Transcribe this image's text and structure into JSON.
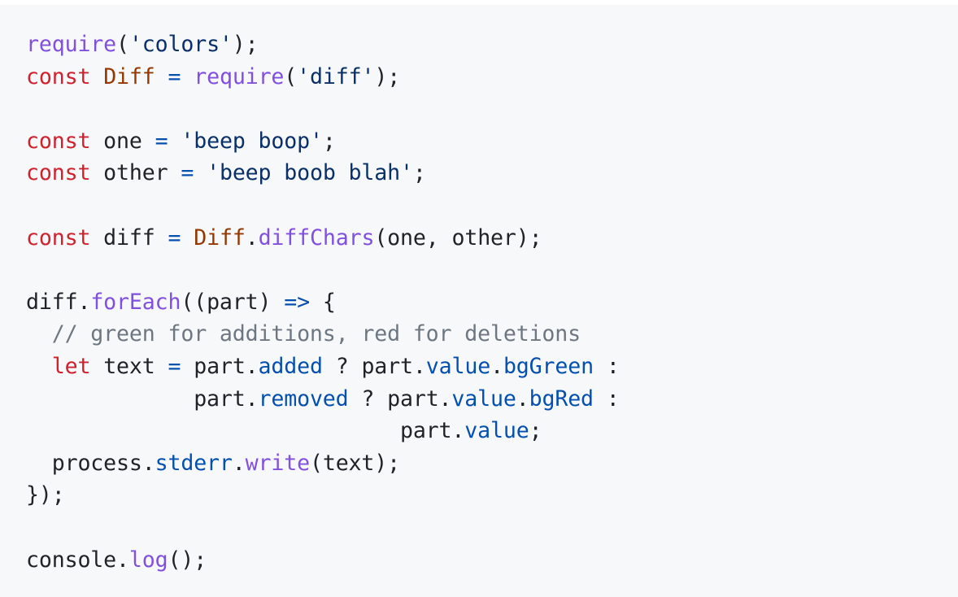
{
  "code_block": {
    "language": "javascript",
    "colors": {
      "background": "#f6f8fa",
      "text": "#1f2328",
      "keyword": "#cf222e",
      "function": "#8250df",
      "class": "#953800",
      "string": "#0a3069",
      "property": "#0550ae",
      "comment": "#6e7781"
    },
    "lines": [
      [
        {
          "t": "fn",
          "v": "require"
        },
        {
          "t": "tx",
          "v": "("
        },
        {
          "t": "str",
          "v": "'colors'"
        },
        {
          "t": "tx",
          "v": ");"
        }
      ],
      [
        {
          "t": "kw",
          "v": "const"
        },
        {
          "t": "tx",
          "v": " "
        },
        {
          "t": "cls",
          "v": "Diff"
        },
        {
          "t": "tx",
          "v": " "
        },
        {
          "t": "op",
          "v": "="
        },
        {
          "t": "tx",
          "v": " "
        },
        {
          "t": "fn",
          "v": "require"
        },
        {
          "t": "tx",
          "v": "("
        },
        {
          "t": "str",
          "v": "'diff'"
        },
        {
          "t": "tx",
          "v": ");"
        }
      ],
      [],
      [
        {
          "t": "kw",
          "v": "const"
        },
        {
          "t": "tx",
          "v": " one "
        },
        {
          "t": "op",
          "v": "="
        },
        {
          "t": "tx",
          "v": " "
        },
        {
          "t": "str",
          "v": "'beep boop'"
        },
        {
          "t": "tx",
          "v": ";"
        }
      ],
      [
        {
          "t": "kw",
          "v": "const"
        },
        {
          "t": "tx",
          "v": " other "
        },
        {
          "t": "op",
          "v": "="
        },
        {
          "t": "tx",
          "v": " "
        },
        {
          "t": "str",
          "v": "'beep boob blah'"
        },
        {
          "t": "tx",
          "v": ";"
        }
      ],
      [],
      [
        {
          "t": "kw",
          "v": "const"
        },
        {
          "t": "tx",
          "v": " diff "
        },
        {
          "t": "op",
          "v": "="
        },
        {
          "t": "tx",
          "v": " "
        },
        {
          "t": "cls",
          "v": "Diff"
        },
        {
          "t": "tx",
          "v": "."
        },
        {
          "t": "fn",
          "v": "diffChars"
        },
        {
          "t": "tx",
          "v": "(one, other);"
        }
      ],
      [],
      [
        {
          "t": "tx",
          "v": "diff."
        },
        {
          "t": "fn",
          "v": "forEach"
        },
        {
          "t": "tx",
          "v": "((part) "
        },
        {
          "t": "op",
          "v": "=>"
        },
        {
          "t": "tx",
          "v": " {"
        }
      ],
      [
        {
          "t": "cm",
          "v": "  // green for additions, red for deletions"
        }
      ],
      [
        {
          "t": "tx",
          "v": "  "
        },
        {
          "t": "kw",
          "v": "let"
        },
        {
          "t": "tx",
          "v": " text "
        },
        {
          "t": "op",
          "v": "="
        },
        {
          "t": "tx",
          "v": " part."
        },
        {
          "t": "prop",
          "v": "added"
        },
        {
          "t": "tx",
          "v": " ? part."
        },
        {
          "t": "prop",
          "v": "value"
        },
        {
          "t": "tx",
          "v": "."
        },
        {
          "t": "prop",
          "v": "bgGreen"
        },
        {
          "t": "tx",
          "v": " :"
        }
      ],
      [
        {
          "t": "tx",
          "v": "             part."
        },
        {
          "t": "prop",
          "v": "removed"
        },
        {
          "t": "tx",
          "v": " ? part."
        },
        {
          "t": "prop",
          "v": "value"
        },
        {
          "t": "tx",
          "v": "."
        },
        {
          "t": "prop",
          "v": "bgRed"
        },
        {
          "t": "tx",
          "v": " :"
        }
      ],
      [
        {
          "t": "tx",
          "v": "                             part."
        },
        {
          "t": "prop",
          "v": "value"
        },
        {
          "t": "tx",
          "v": ";"
        }
      ],
      [
        {
          "t": "tx",
          "v": "  process."
        },
        {
          "t": "prop",
          "v": "stderr"
        },
        {
          "t": "tx",
          "v": "."
        },
        {
          "t": "fn",
          "v": "write"
        },
        {
          "t": "tx",
          "v": "(text);"
        }
      ],
      [
        {
          "t": "tx",
          "v": "});"
        }
      ],
      [],
      [
        {
          "t": "tx",
          "v": "console."
        },
        {
          "t": "fn",
          "v": "log"
        },
        {
          "t": "tx",
          "v": "();"
        }
      ]
    ]
  }
}
